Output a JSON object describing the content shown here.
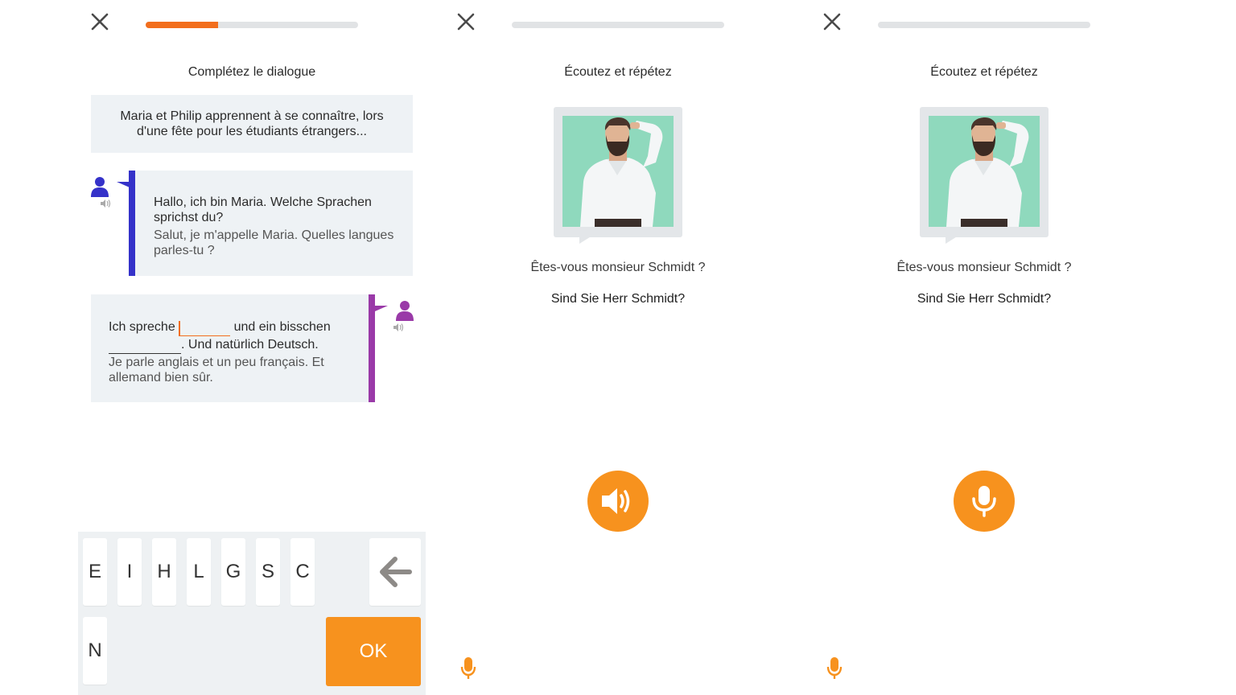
{
  "colors": {
    "accent": "#f7921e",
    "progress": "#f26e1d",
    "speaker1": "#3532c9",
    "speaker2": "#9a3aa8",
    "panel_bg": "#eef2f5"
  },
  "panel1": {
    "progress": 0.34,
    "title": "Complétez le dialogue",
    "intro": "Maria et Philip apprennent à se connaître, lors d'une fête pour les étudiants étrangers...",
    "dialogue": [
      {
        "speaker_icon": "user-icon",
        "de": "Hallo, ich bin Maria. Welche Sprachen sprichst du?",
        "fr": "Salut, je m'appelle Maria. Quelles langues parles-tu ?"
      },
      {
        "speaker_icon": "user-icon",
        "de_part1": "Ich spreche",
        "de_part2": "und ein bisschen",
        "de_part3": ". Und natürlich Deutsch.",
        "fr": "Je parle anglais et un peu français. Et allemand bien sûr."
      }
    ],
    "keyboard": {
      "keys": [
        "E",
        "I",
        "H",
        "L",
        "G",
        "S",
        "C",
        "N"
      ],
      "backspace_icon": "arrow-left-icon",
      "ok_label": "OK"
    }
  },
  "panel2": {
    "progress": 0,
    "title": "Écoutez et répétez",
    "phrase_fr": "Êtes-vous monsieur Schmidt ?",
    "phrase_de": "Sind Sie Herr Schmidt?",
    "main_button_icon": "speaker-icon",
    "corner_icon": "microphone-icon"
  },
  "panel3": {
    "progress": 0,
    "title": "Écoutez et répétez",
    "phrase_fr": "Êtes-vous monsieur Schmidt ?",
    "phrase_de": "Sind Sie Herr Schmidt?",
    "main_button_icon": "microphone-icon",
    "corner_icon": "microphone-icon"
  }
}
